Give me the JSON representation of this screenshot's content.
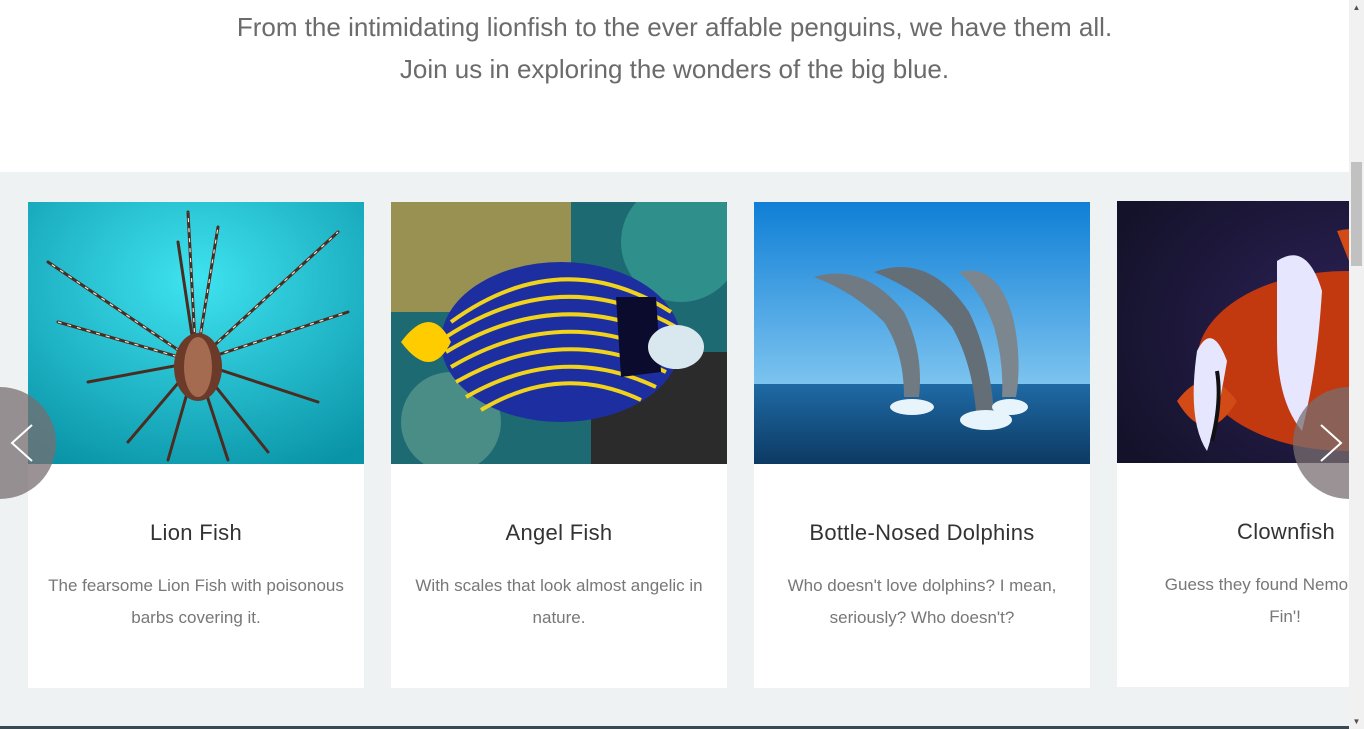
{
  "intro": {
    "line1": "From the intimidating lionfish to the ever affable penguins, we have them all.",
    "line2": "Join us in exploring the wonders of the big blue."
  },
  "cards": [
    {
      "title": "Lion Fish",
      "description": "The fearsome Lion Fish with poisonous barbs covering it."
    },
    {
      "title": "Angel Fish",
      "description": "With scales that look almost angelic in nature."
    },
    {
      "title": "Bottle-Nosed Dolphins",
      "description": "Who doesn't love dolphins? I mean, seriously? Who doesn't?"
    },
    {
      "title": "Clownfish",
      "description": "Guess they found Nemo, 'Lucky Fin'!"
    }
  ],
  "nav": {
    "prev_icon": "chevron-left-icon",
    "next_icon": "chevron-right-icon"
  },
  "colors": {
    "carousel_bg": "#eff2f3",
    "nav_bg": "#786e70",
    "text": "#333333"
  }
}
